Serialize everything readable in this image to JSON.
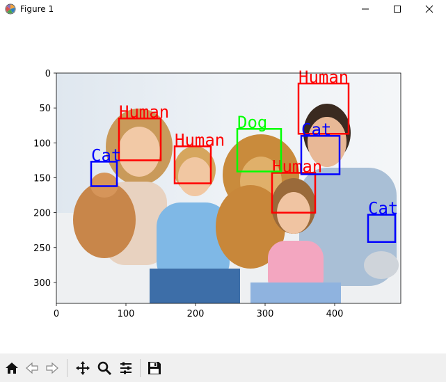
{
  "window": {
    "title": "Figure 1",
    "icons": {
      "app": "matplotlib-figure-icon",
      "minimize": "minimize-icon",
      "maximize": "maximize-icon",
      "close": "close-icon"
    }
  },
  "toolbar": {
    "buttons": [
      {
        "name": "home-icon"
      },
      {
        "name": "back-arrow-icon"
      },
      {
        "name": "forward-arrow-icon"
      },
      {
        "name": "pan-move-icon"
      },
      {
        "name": "zoom-magnifier-icon"
      },
      {
        "name": "subplots-config-icon"
      },
      {
        "name": "save-floppy-icon"
      }
    ]
  },
  "chart_data": {
    "type": "image",
    "x_ticks": [
      0,
      100,
      200,
      300,
      400
    ],
    "y_ticks": [
      0,
      50,
      100,
      150,
      200,
      250,
      300
    ],
    "xlim": [
      0,
      495
    ],
    "ylim": [
      330,
      0
    ],
    "detections": [
      {
        "label": "Human",
        "color": "#ff0000",
        "x0": 90,
        "y0": 65,
        "x1": 150,
        "y1": 125
      },
      {
        "label": "Human",
        "color": "#ff0000",
        "x0": 170,
        "y0": 105,
        "x1": 222,
        "y1": 158
      },
      {
        "label": "Human",
        "color": "#ff0000",
        "x0": 348,
        "y0": 15,
        "x1": 420,
        "y1": 87
      },
      {
        "label": "Human",
        "color": "#ff0000",
        "x0": 310,
        "y0": 143,
        "x1": 372,
        "y1": 200
      },
      {
        "label": "Dog",
        "color": "#00ff00",
        "x0": 260,
        "y0": 80,
        "x1": 323,
        "y1": 141
      },
      {
        "label": "Cat",
        "color": "#0000ff",
        "x0": 50,
        "y0": 127,
        "x1": 87,
        "y1": 162
      },
      {
        "label": "Cat",
        "color": "#0000ff",
        "x0": 352,
        "y0": 90,
        "x1": 407,
        "y1": 145
      },
      {
        "label": "Cat",
        "color": "#0000ff",
        "x0": 448,
        "y0": 203,
        "x1": 487,
        "y1": 242
      }
    ]
  }
}
